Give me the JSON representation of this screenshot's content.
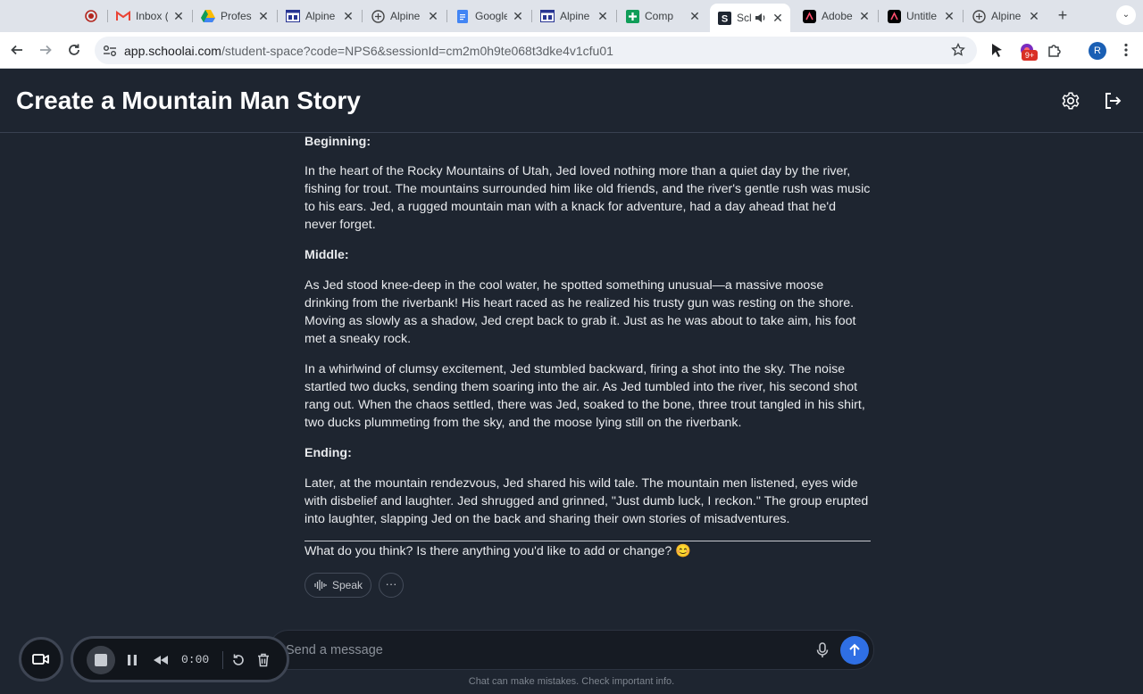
{
  "browser": {
    "tabs": [
      {
        "label": "",
        "icon": "record-icon",
        "active": false
      },
      {
        "label": "Inbox (",
        "icon": "gmail-icon",
        "active": false
      },
      {
        "label": "Profes",
        "icon": "google-drive-icon",
        "active": false
      },
      {
        "label": "Alpine",
        "icon": "alpine-doc-icon",
        "active": false
      },
      {
        "label": "Alpine",
        "icon": "chatgpt-icon",
        "active": false
      },
      {
        "label": "Google",
        "icon": "google-docs-icon",
        "active": false
      },
      {
        "label": "Alpine",
        "icon": "alpine-doc-icon",
        "active": false
      },
      {
        "label": "Comp",
        "icon": "google-sheets-plus-icon",
        "active": false
      },
      {
        "label": "Scl",
        "icon": "schoolai-icon",
        "active": true
      },
      {
        "label": "Adobe",
        "icon": "adobe-express-icon",
        "active": false
      },
      {
        "label": "Untitle",
        "icon": "adobe-express-icon",
        "active": false
      },
      {
        "label": "Alpine",
        "icon": "chatgpt-icon",
        "active": false
      }
    ],
    "url_host": "app.schoolai.com",
    "url_path": "/student-space?code=NPS6&sessionId=cm2m0h9te068t3dke4v1cfu01",
    "extension_badge": "9+",
    "profile_initial": "R"
  },
  "app": {
    "title": "Create a Mountain Man Story",
    "accent": "#2f6fe4"
  },
  "story": {
    "beginning_heading": "Beginning:",
    "beginning_text": "In the heart of the Rocky Mountains of Utah, Jed loved nothing more than a quiet day by the river, fishing for trout. The mountains surrounded him like old friends, and the river's gentle rush was music to his ears. Jed, a rugged mountain man with a knack for adventure, had a day ahead that he'd never forget.",
    "middle_heading": "Middle:",
    "middle_text_1": "As Jed stood knee-deep in the cool water, he spotted something unusual—a massive moose drinking from the riverbank! His heart raced as he realized his trusty gun was resting on the shore. Moving as slowly as a shadow, Jed crept back to grab it. Just as he was about to take aim, his foot met a sneaky rock.",
    "middle_text_2": "In a whirlwind of clumsy excitement, Jed stumbled backward, firing a shot into the sky. The noise startled two ducks, sending them soaring into the air. As Jed tumbled into the river, his second shot rang out. When the chaos settled, there was Jed, soaked to the bone, three trout tangled in his shirt, two ducks plummeting from the sky, and the moose lying still on the riverbank.",
    "ending_heading": "Ending:",
    "ending_text": "Later, at the mountain rendezvous, Jed shared his wild tale. The mountain men listened, eyes wide with disbelief and laughter. Jed shrugged and grinned, \"Just dumb luck, I reckon.\" The group erupted into laughter, slapping Jed on the back and sharing their own stories of misadventures.",
    "question": "What do you think? Is there anything you'd like to add or change? 😊"
  },
  "actions": {
    "speak_label": "Speak",
    "more_label": "···"
  },
  "composer": {
    "placeholder": "Send a message",
    "footnote": "Chat can make mistakes. Check important info."
  },
  "recorder": {
    "time": "0:00"
  }
}
